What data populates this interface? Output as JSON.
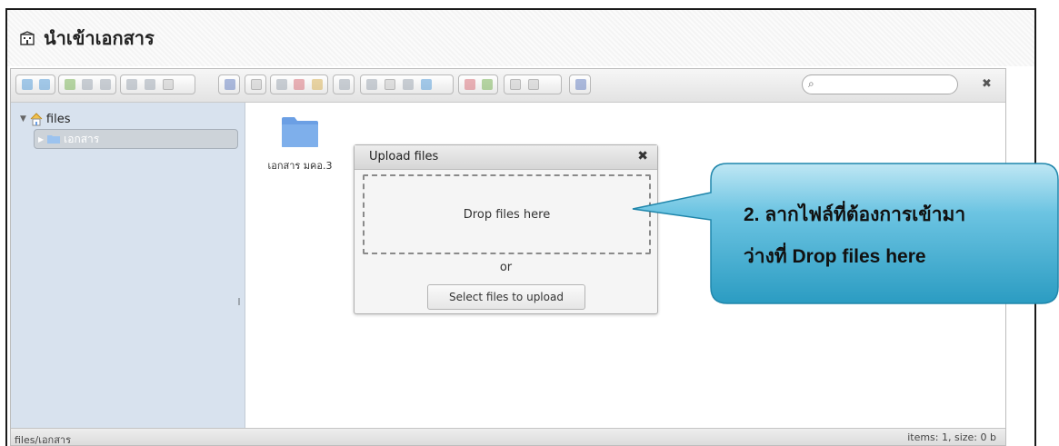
{
  "window": {
    "title": "นำเข้าเอกสาร"
  },
  "search": {
    "placeholder": ""
  },
  "tree": {
    "root_label": "files",
    "child_label": "เอกสาร"
  },
  "content": {
    "items": [
      {
        "name": "เอกสาร มคอ.3",
        "icon": "folder-icon"
      }
    ]
  },
  "statusbar": {
    "path": "files/เอกสาร",
    "info": "items: 1, size: 0 b"
  },
  "upload_dialog": {
    "title": "Upload files",
    "dropzone_text": "Drop files here",
    "or_text": "or",
    "select_button": "Select files to upload"
  },
  "callout": {
    "line1": "2. ลากไฟล์ที่ต้องการเข้ามา",
    "line2": "ว่างที่ Drop files here"
  },
  "colors": {
    "callout_fill": "#3aa7c9",
    "sidebar_bg": "#d8e2ee",
    "folder": "#6b9fe4"
  }
}
